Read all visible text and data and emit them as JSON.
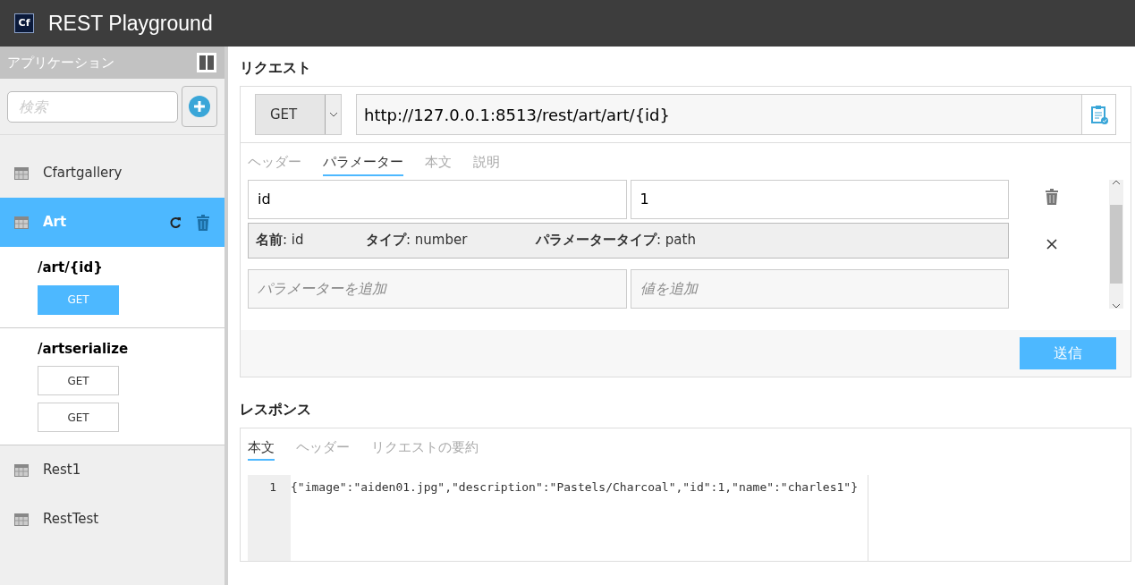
{
  "app": {
    "title": "REST Playground",
    "logo": "Cf"
  },
  "sidebar": {
    "title": "アプリケーション",
    "search": {
      "placeholder": "検索"
    },
    "apps": [
      {
        "name": "Cfartgallery",
        "selected": false
      },
      {
        "name": "Art",
        "selected": true,
        "expanded": true,
        "endpoints": [
          {
            "path": "/art/{id}",
            "methods": [
              {
                "label": "GET",
                "selected": true
              }
            ]
          },
          {
            "path": "/artserialize",
            "methods": [
              {
                "label": "GET",
                "selected": false
              },
              {
                "label": "GET",
                "selected": false
              }
            ]
          }
        ]
      },
      {
        "name": "Rest1",
        "selected": false
      },
      {
        "name": "RestTest",
        "selected": false
      }
    ]
  },
  "request": {
    "title": "リクエスト",
    "method": "GET",
    "url": "http://127.0.0.1:8513/rest/art/art/{id}",
    "tabs": [
      {
        "label": "ヘッダー",
        "selected": false
      },
      {
        "label": "パラメーター",
        "selected": true
      },
      {
        "label": "本文",
        "selected": false
      },
      {
        "label": "説明",
        "selected": false
      }
    ],
    "params": [
      {
        "name": "id",
        "value": "1",
        "info": [
          "**名前**: id",
          "**タイプ**: number",
          "**パラメータータイプ**: path"
        ]
      }
    ],
    "new_param": {
      "name_placeholder": "パラメーターを追加",
      "value_placeholder": "値を追加"
    },
    "send": "送信"
  },
  "response": {
    "title": "レスポンス",
    "tabs": [
      {
        "label": "本文",
        "selected": true
      },
      {
        "label": "ヘッダー",
        "selected": false
      },
      {
        "label": "リクエストの要約",
        "selected": false
      }
    ],
    "lines": [
      {
        "number": "1",
        "text": "{\"image\":\"aiden01.jpg\",\"description\":\"Pastels/Charcoal\",\"id\":1,\"name\":\"charles1\"}"
      }
    ]
  }
}
